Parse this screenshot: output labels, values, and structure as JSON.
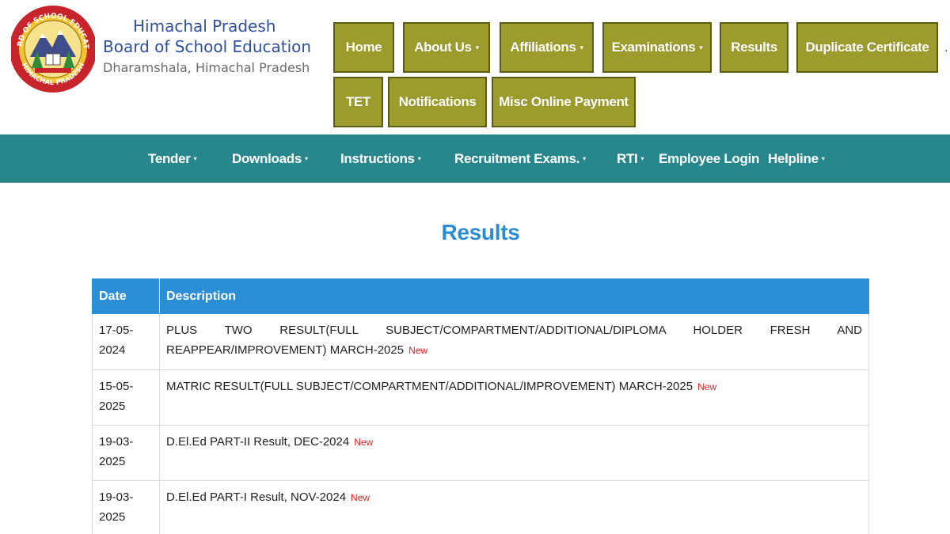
{
  "header": {
    "logo": {
      "ring_top": "BOARD OF SCHOOL EDUCATION",
      "ring_bottom": "HIMACHAL PRADESH",
      "icon": "emblem-logo-icon",
      "colors": {
        "ring": "#c8242b",
        "inner": "#f2c331",
        "mountain": "#3f4d8a",
        "tree": "#2f8d3a"
      }
    },
    "org_line1": "Himachal Pradesh",
    "org_line2": "Board of School Education",
    "org_line3": "Dharamshala, Himachal Pradesh"
  },
  "topnav": [
    {
      "label": "Home",
      "dropdown": false
    },
    {
      "label": "About Us",
      "dropdown": true
    },
    {
      "label": "Affiliations",
      "dropdown": true
    },
    {
      "label": "Examinations",
      "dropdown": true
    },
    {
      "label": "Results",
      "dropdown": false
    },
    {
      "label": "Duplicate Certificate",
      "dropdown": false
    },
    {
      "label": "TET",
      "dropdown": false
    },
    {
      "label": "Notifications",
      "dropdown": false
    },
    {
      "label": "Misc Online Payment",
      "dropdown": false
    }
  ],
  "caret_icon": "▾",
  "overflow_dot": ".",
  "secondary_nav": [
    {
      "label": "Tender",
      "dropdown": true
    },
    {
      "label": "Downloads",
      "dropdown": true
    },
    {
      "label": "Instructions",
      "dropdown": true
    },
    {
      "label": "Recruitment Exams.",
      "dropdown": true
    },
    {
      "label": "RTI",
      "dropdown": true
    },
    {
      "label": "Employee Login",
      "dropdown": false
    },
    {
      "label": "Helpline",
      "dropdown": true
    }
  ],
  "page_title": "Results",
  "table": {
    "headers": {
      "date": "Date",
      "description": "Description"
    },
    "badge_label": "New",
    "rows": [
      {
        "date_line1": "17-05-",
        "date_line2": "2024",
        "description": "PLUS TWO RESULT(FULL SUBJECT/COMPARTMENT/ADDITIONAL/DIPLOMA HOLDER FRESH AND REAPPEAR/IMPROVEMENT) MARCH-2025",
        "is_new": true
      },
      {
        "date_line1": "15-05-",
        "date_line2": "2025",
        "description": "MATRIC RESULT(FULL SUBJECT/COMPARTMENT/ADDITIONAL/IMPROVEMENT) MARCH-2025",
        "is_new": true
      },
      {
        "date_line1": "19-03-",
        "date_line2": "2025",
        "description": "D.El.Ed PART-II Result, DEC-2024",
        "is_new": true
      },
      {
        "date_line1": "19-03-",
        "date_line2": "2025",
        "description": "D.El.Ed PART-I Result, NOV-2024",
        "is_new": true
      }
    ]
  },
  "colors": {
    "nav_button": "#9c9c2c",
    "nav_button_border": "#5c5c12",
    "secondary_bar": "#27878c",
    "title": "#2a8dd4",
    "table_header": "#2b8fd6",
    "new_badge": "#e0201c",
    "org_name": "#2d4f9c"
  }
}
